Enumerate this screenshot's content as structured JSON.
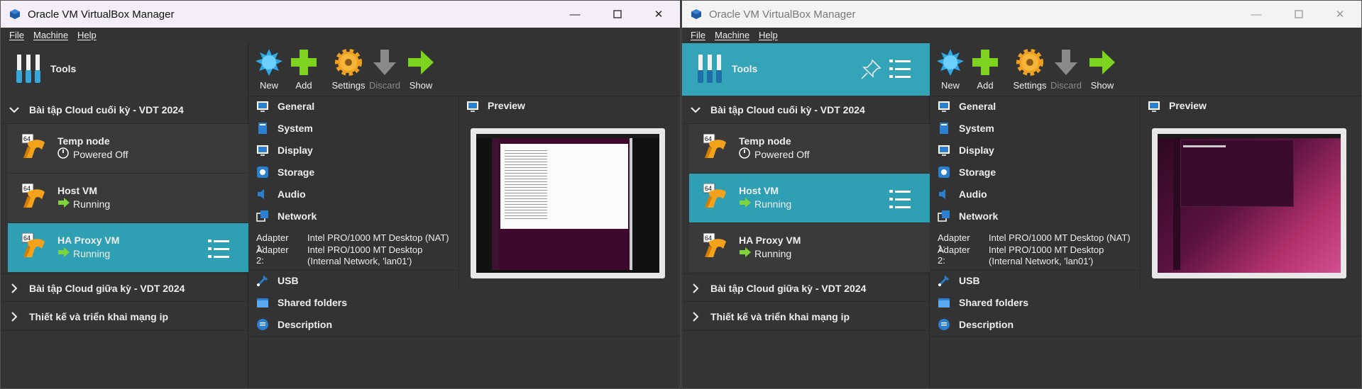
{
  "windows": [
    {
      "title": "Oracle VM VirtualBox Manager",
      "menu": [
        "File",
        "Machine",
        "Help"
      ],
      "tools_label": "Tools",
      "toolbar": [
        {
          "label": "New",
          "icon": "new-icon"
        },
        {
          "label": "Add",
          "icon": "add-icon"
        },
        {
          "label": "Settings",
          "icon": "settings-icon"
        },
        {
          "label": "Discard",
          "icon": "discard-icon",
          "disabled": true
        },
        {
          "label": "Show",
          "icon": "show-icon"
        }
      ],
      "groups": [
        {
          "label": "Bài tập Cloud cuối kỳ - VDT 2024",
          "expanded": true
        },
        {
          "label": "Bài tập Cloud giữa kỳ - VDT 2024",
          "expanded": false
        },
        {
          "label": "Thiết kế và triển khai mạng ip",
          "expanded": false
        }
      ],
      "vms": [
        {
          "name": "Temp node",
          "state": "Powered Off",
          "selected": false
        },
        {
          "name": "Host VM",
          "state": "Running",
          "selected": false
        },
        {
          "name": "HA Proxy VM",
          "state": "Running",
          "selected": true
        }
      ],
      "details": {
        "sections": [
          "General",
          "System",
          "Display",
          "Storage",
          "Audio",
          "Network"
        ],
        "network": [
          {
            "key": "Adapter 1:",
            "value": "Intel PRO/1000 MT Desktop (NAT)"
          },
          {
            "key": "Adapter 2:",
            "value": "Intel PRO/1000 MT Desktop",
            "value2": "(Internal Network, 'lan01')"
          }
        ],
        "bottom_sections": [
          "USB",
          "Shared folders",
          "Description"
        ],
        "preview_label": "Preview"
      }
    },
    {
      "title": "Oracle VM VirtualBox Manager",
      "menu": [
        "File",
        "Machine",
        "Help"
      ],
      "tools_label": "Tools",
      "toolbar": [
        {
          "label": "New",
          "icon": "new-icon"
        },
        {
          "label": "Add",
          "icon": "add-icon"
        },
        {
          "label": "Settings",
          "icon": "settings-icon"
        },
        {
          "label": "Discard",
          "icon": "discard-icon",
          "disabled": true
        },
        {
          "label": "Show",
          "icon": "show-icon"
        }
      ],
      "groups": [
        {
          "label": "Bài tập Cloud cuối kỳ - VDT 2024",
          "expanded": true
        },
        {
          "label": "Bài tập Cloud giữa kỳ - VDT 2024",
          "expanded": false
        },
        {
          "label": "Thiết kế và triển khai mạng ip",
          "expanded": false
        }
      ],
      "vms": [
        {
          "name": "Temp node",
          "state": "Powered Off",
          "selected": false
        },
        {
          "name": "Host VM",
          "state": "Running",
          "selected": true
        },
        {
          "name": "HA Proxy VM",
          "state": "Running",
          "selected": false
        }
      ],
      "details": {
        "sections": [
          "General",
          "System",
          "Display",
          "Storage",
          "Audio",
          "Network"
        ],
        "network": [
          {
            "key": "Adapter 1:",
            "value": "Intel PRO/1000 MT Desktop (NAT)"
          },
          {
            "key": "Adapter 2:",
            "value": "Intel PRO/1000 MT Desktop",
            "value2": "(Internal Network, 'lan01')"
          }
        ],
        "bottom_sections": [
          "USB",
          "Shared folders",
          "Description"
        ],
        "preview_label": "Preview"
      }
    }
  ],
  "colors": {
    "selection": "#2f9fb3",
    "background": "#333333",
    "text": "#eeeeee"
  }
}
